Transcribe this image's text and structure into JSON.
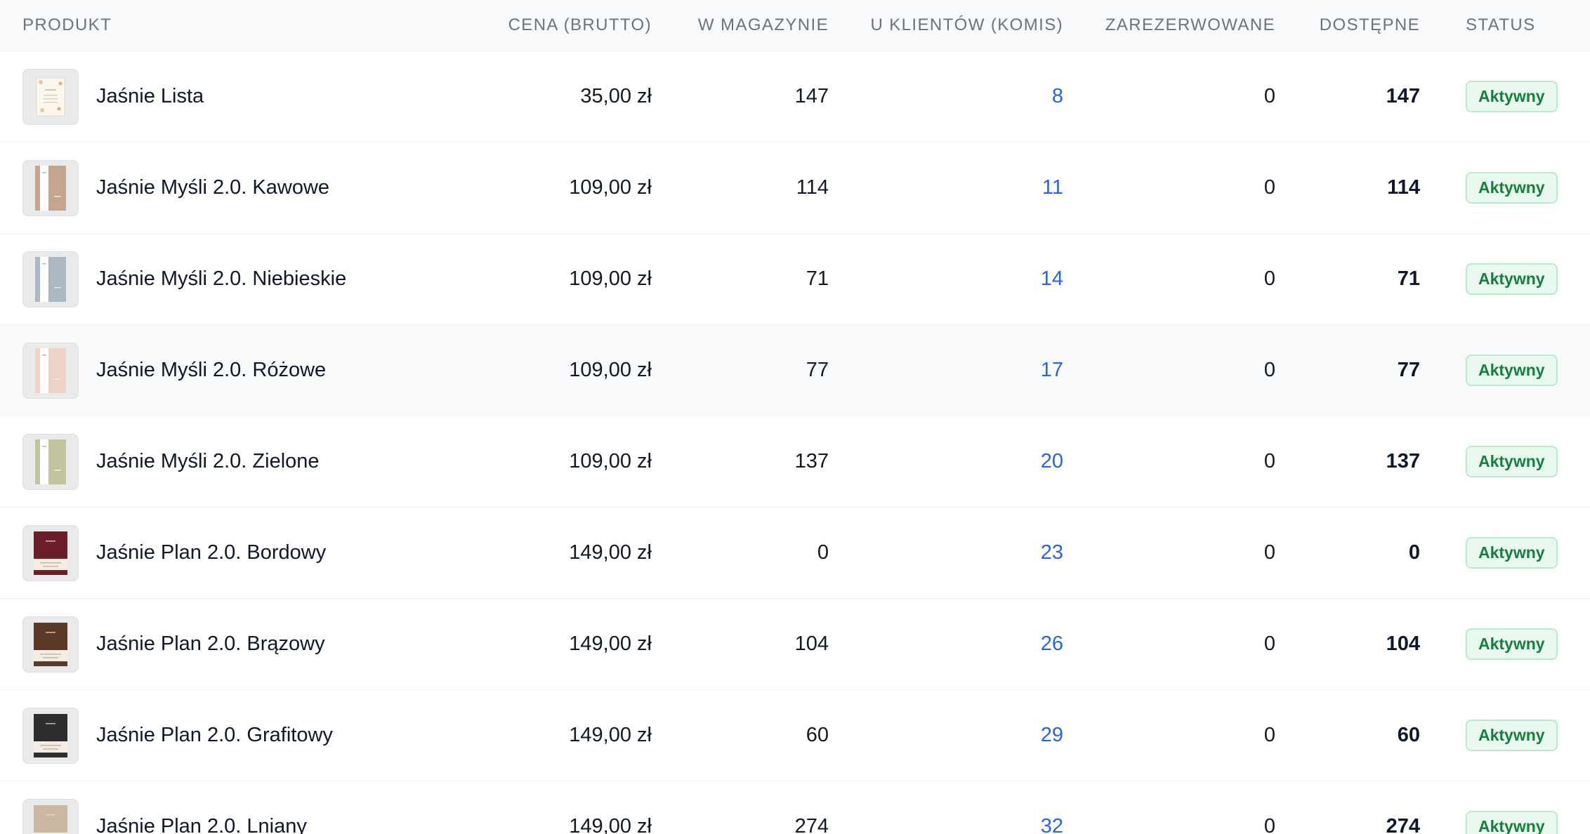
{
  "columns": {
    "product": "PRODUKT",
    "price": "CENA (BRUTTO)",
    "stock": "W MAGAZYNIE",
    "consignment": "U KLIENTÓW (KOMIS)",
    "reserved": "ZAREZERWOWANE",
    "available": "DOSTĘPNE",
    "status": "STATUS"
  },
  "colors": {
    "consignment_link": "#2563eb",
    "status_badge_text": "#15803d",
    "status_badge_bg": "#e9f9ef"
  },
  "rows": [
    {
      "name": "Jaśnie Lista",
      "price": "35,00 zł",
      "stock": "147",
      "consignment": "8",
      "reserved": "0",
      "available": "147",
      "status": "Aktywny",
      "thumb": "list-card",
      "thumb_color": "#f6efe2"
    },
    {
      "name": "Jaśnie Myśli 2.0. Kawowe",
      "price": "109,00 zł",
      "stock": "114",
      "consignment": "11",
      "reserved": "0",
      "available": "114",
      "status": "Aktywny",
      "thumb": "notebook-open",
      "thumb_color": "#c4a590"
    },
    {
      "name": "Jaśnie Myśli 2.0. Niebieskie",
      "price": "109,00 zł",
      "stock": "71",
      "consignment": "14",
      "reserved": "0",
      "available": "71",
      "status": "Aktywny",
      "thumb": "notebook-open",
      "thumb_color": "#a9b8c2"
    },
    {
      "name": "Jaśnie Myśli 2.0. Różowe",
      "price": "109,00 zł",
      "stock": "77",
      "consignment": "17",
      "reserved": "0",
      "available": "77",
      "status": "Aktywny",
      "thumb": "notebook-open",
      "thumb_color": "#ecd3c5"
    },
    {
      "name": "Jaśnie Myśli 2.0. Zielone",
      "price": "109,00 zł",
      "stock": "137",
      "consignment": "20",
      "reserved": "0",
      "available": "137",
      "status": "Aktywny",
      "thumb": "notebook-open",
      "thumb_color": "#c3c49e"
    },
    {
      "name": "Jaśnie Plan 2.0. Bordowy",
      "price": "149,00 zł",
      "stock": "0",
      "consignment": "23",
      "reserved": "0",
      "available": "0",
      "status": "Aktywny",
      "thumb": "planner",
      "thumb_color": "#6b1f28"
    },
    {
      "name": "Jaśnie Plan 2.0. Brązowy",
      "price": "149,00 zł",
      "stock": "104",
      "consignment": "26",
      "reserved": "0",
      "available": "104",
      "status": "Aktywny",
      "thumb": "planner",
      "thumb_color": "#5c3a28"
    },
    {
      "name": "Jaśnie Plan 2.0. Grafitowy",
      "price": "149,00 zł",
      "stock": "60",
      "consignment": "29",
      "reserved": "0",
      "available": "60",
      "status": "Aktywny",
      "thumb": "planner",
      "thumb_color": "#2e2e30"
    },
    {
      "name": "Jaśnie Plan 2.0. Lniany",
      "price": "149,00 zł",
      "stock": "274",
      "consignment": "32",
      "reserved": "0",
      "available": "274",
      "status": "Aktywny",
      "thumb": "planner",
      "thumb_color": "#cbb8a2"
    }
  ]
}
